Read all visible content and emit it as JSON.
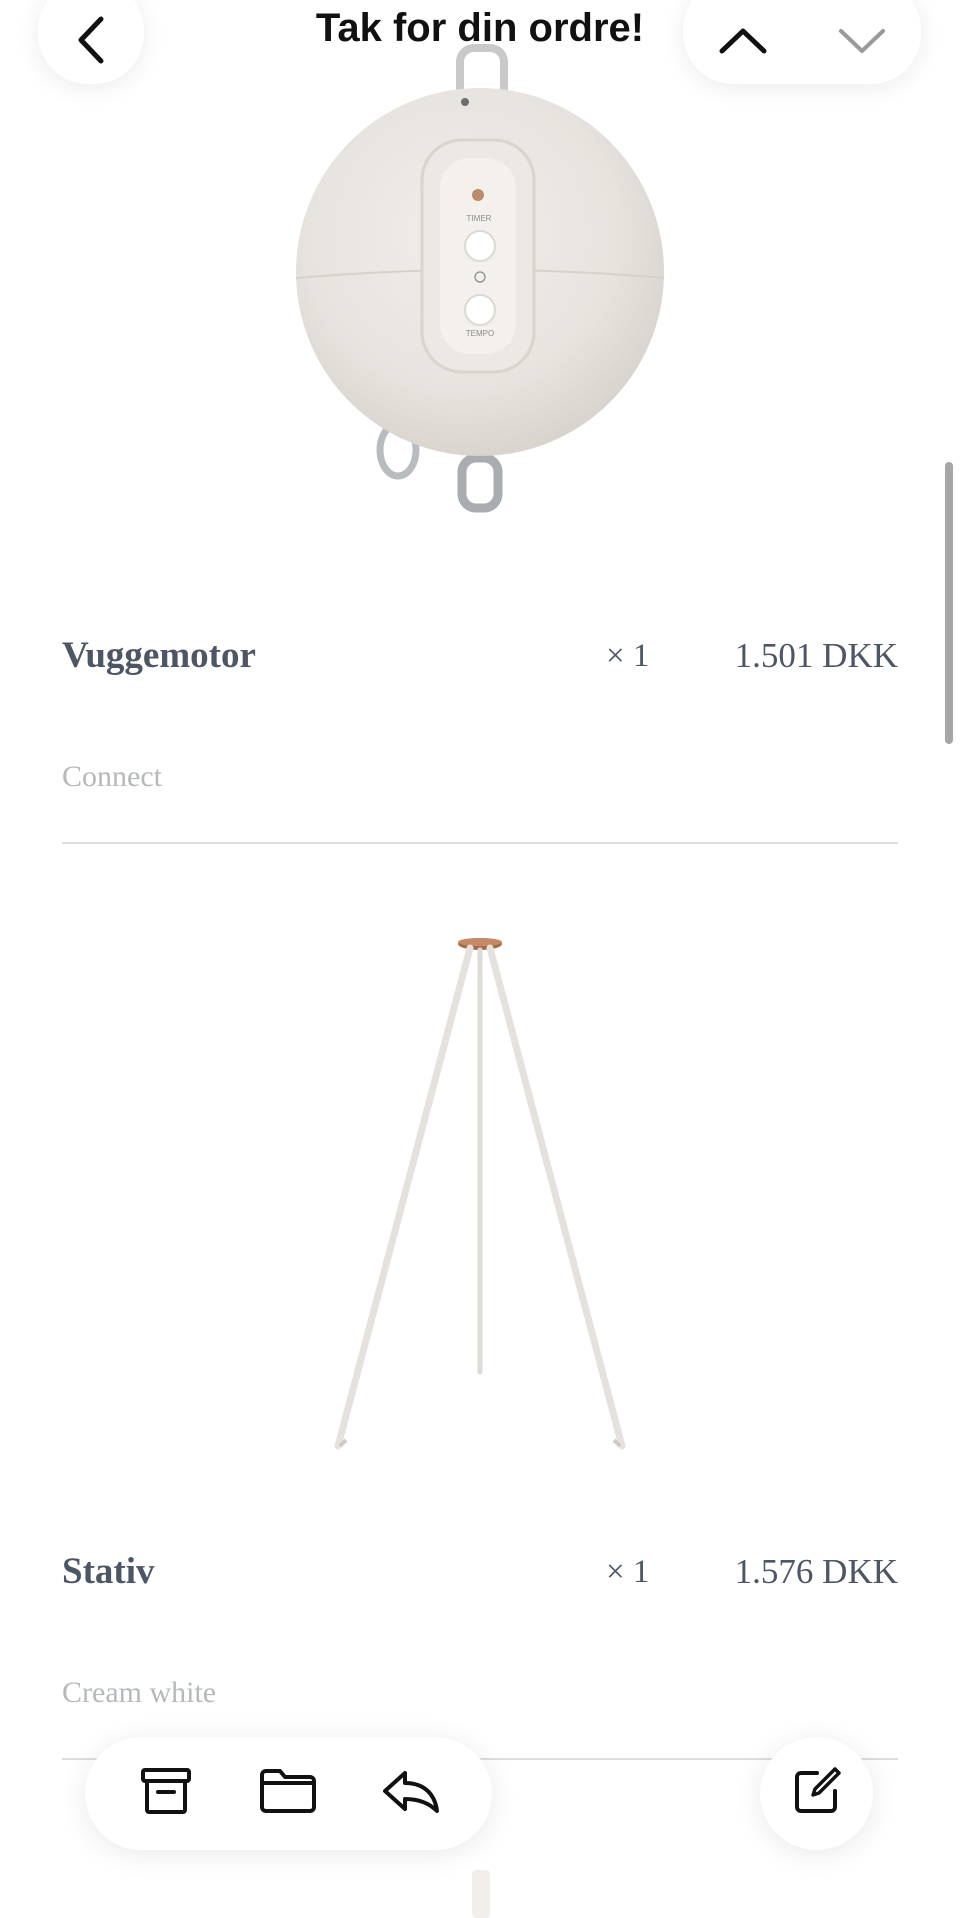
{
  "header": {
    "title": "Tak for din ordre!"
  },
  "products": [
    {
      "name": "Vuggemotor",
      "quantity": "× 1",
      "price": "1.501 DKK",
      "variant": "Connect"
    },
    {
      "name": "Stativ",
      "quantity": "× 1",
      "price": "1.576 DKK",
      "variant": "Cream white"
    }
  ],
  "icons": {
    "back": "chevron-left-icon",
    "prev": "chevron-up-icon",
    "next": "chevron-down-icon",
    "archive": "archive-icon",
    "folder": "folder-icon",
    "reply": "reply-icon",
    "compose": "compose-icon"
  }
}
